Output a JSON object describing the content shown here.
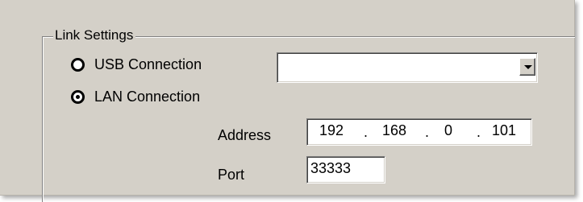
{
  "group": {
    "title": "Link Settings"
  },
  "connection": {
    "usb_label": "USB Connection",
    "lan_label": "LAN Connection",
    "selected": "LAN Connection",
    "usb_device_value": ""
  },
  "address": {
    "label": "Address",
    "octets": [
      "192",
      "168",
      "0",
      "101"
    ],
    "separator": "."
  },
  "port": {
    "label": "Port",
    "value": "33333"
  },
  "icons": {
    "dropdown": "chevron-down-icon"
  }
}
